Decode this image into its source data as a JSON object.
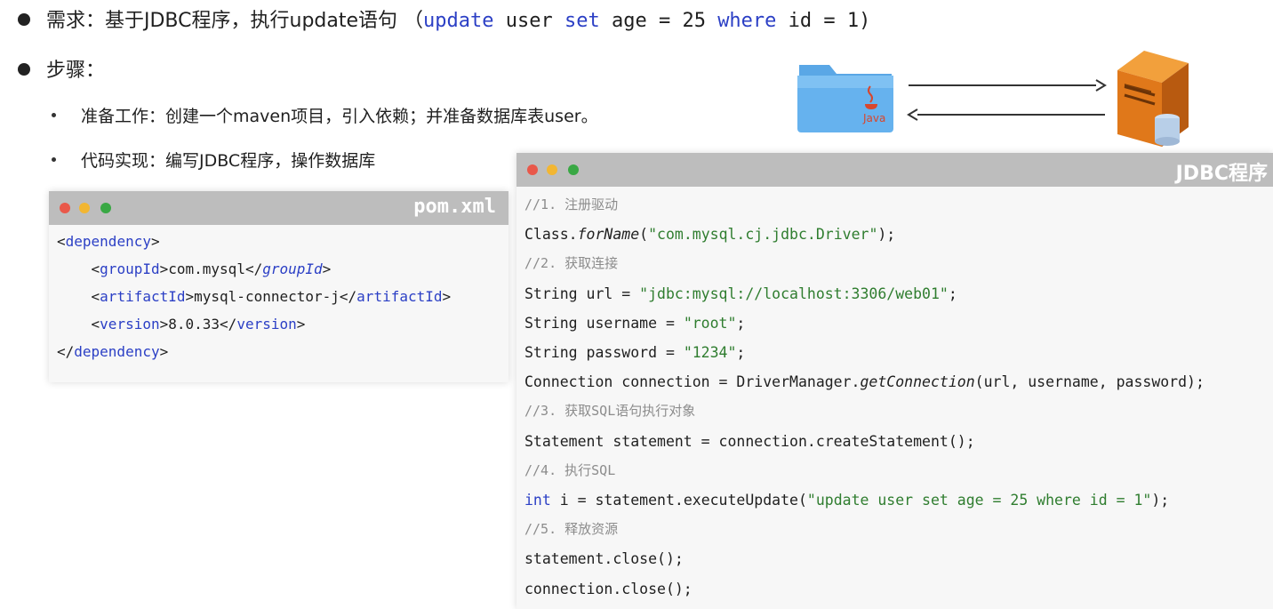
{
  "requirement": {
    "prefix": "需求：基于JDBC程序，执行update语句 （",
    "kw_update": "update",
    "t_user": " user ",
    "kw_set": "set",
    "t_age": " age = 25 ",
    "kw_where": "where",
    "t_id": " id = 1)"
  },
  "steps": {
    "title": "步骤：",
    "items": [
      "准备工作：创建一个maven项目，引入依赖；并准备数据库表user。",
      "代码实现：编写JDBC程序，操作数据库"
    ]
  },
  "diagram": {
    "java_label": "Java"
  },
  "pom": {
    "title": "pom.xml",
    "lines": {
      "dep_open": "dependency",
      "group_tag": "groupId",
      "group_val": "com.mysql",
      "artifact_tag": "artifactId",
      "artifact_val": "mysql-connector-j",
      "version_tag": "version",
      "version_val": "8.0.33",
      "dep_close": "dependency"
    }
  },
  "jdbc": {
    "title": "JDBC程序",
    "c1": "//1. 注册驱动",
    "l1a": "Class.",
    "l1b": "forName",
    "l1c": "(",
    "l1s": "\"com.mysql.cj.jdbc.Driver\"",
    "l1d": ");",
    "c2": "//2. 获取连接",
    "l2a": "String url = ",
    "l2s": "\"jdbc:mysql://localhost:3306/web01\"",
    "l2b": ";",
    "l3a": "String username = ",
    "l3s": "\"root\"",
    "l3b": ";",
    "l4a": "String password = ",
    "l4s": "\"1234\"",
    "l4b": ";",
    "l5a": "Connection connection = DriverManager.",
    "l5b": "getConnection",
    "l5c": "(url, username, password);",
    "c3": "//3. 获取SQL语句执行对象",
    "l6": "Statement statement = connection.createStatement();",
    "c4": "//4. 执行SQL",
    "l7k": "int",
    "l7a": " i = statement.executeUpdate(",
    "l7s": "\"update user set age = 25 where id = 1\"",
    "l7b": ");",
    "c5": "//5. 释放资源",
    "l8": "statement.close();",
    "l9": "connection.close();"
  },
  "colors": {
    "keyword": "#2b3fc5",
    "string": "#2f7d2f",
    "comment": "#8c8c8c"
  }
}
